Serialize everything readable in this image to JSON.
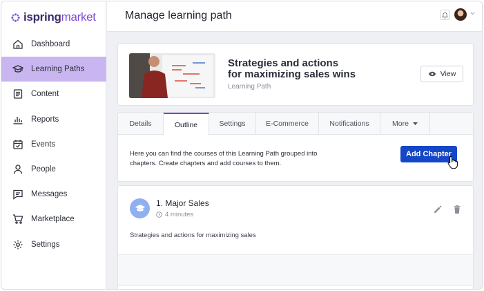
{
  "app": {
    "logo_text_bold": "ispring",
    "logo_text_light": "market",
    "brand_color": "#7c4dd8"
  },
  "sidebar": {
    "items": [
      {
        "label": "Dashboard",
        "icon": "home-icon",
        "active": false
      },
      {
        "label": "Learning Paths",
        "icon": "graduation-cap-icon",
        "active": true
      },
      {
        "label": "Content",
        "icon": "document-icon",
        "active": false
      },
      {
        "label": "Reports",
        "icon": "bar-chart-icon",
        "active": false
      },
      {
        "label": "Events",
        "icon": "calendar-icon",
        "active": false
      },
      {
        "label": "People",
        "icon": "person-icon",
        "active": false
      },
      {
        "label": "Messages",
        "icon": "message-icon",
        "active": false
      },
      {
        "label": "Marketplace",
        "icon": "cart-icon",
        "active": false
      },
      {
        "label": "Settings",
        "icon": "gear-icon",
        "active": false
      }
    ]
  },
  "header": {
    "title": "Manage learning path"
  },
  "path": {
    "title_line1": "Strategies and actions",
    "title_line2": "for maximizing sales wins",
    "subtitle": "Learning Path",
    "view_label": "View"
  },
  "tabs": [
    {
      "label": "Details"
    },
    {
      "label": "Outline"
    },
    {
      "label": "Settings"
    },
    {
      "label": "E-Commerce"
    },
    {
      "label": "Notifications"
    },
    {
      "label": "More"
    }
  ],
  "active_tab": "Outline",
  "outline": {
    "description": "Here you can find the courses of this Learning Path grouped into chapters. Create chapters and add courses to them.",
    "add_chapter_label": "Add Chapter"
  },
  "chapter": {
    "title": "1. Major Sales",
    "duration": "4 minutes",
    "description": "Strategies and actions for maximizing sales"
  }
}
